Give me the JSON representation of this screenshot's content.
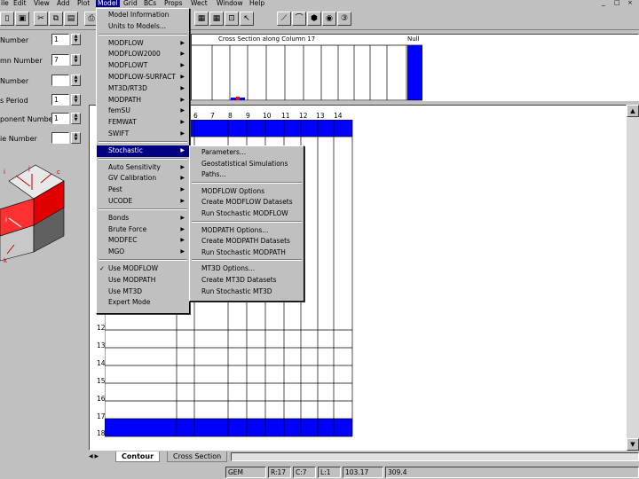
{
  "menubar": {
    "items": [
      "ile",
      "Edit",
      "View",
      "Add",
      "Plot",
      "Model",
      "Grid",
      "BCs",
      "Props",
      "Wect",
      "Window",
      "Help"
    ],
    "win_controls": [
      "_",
      "□",
      "×"
    ]
  },
  "left_panel": {
    "fields": [
      {
        "label": "Number",
        "value": "1"
      },
      {
        "label": "mn Number",
        "value": "7"
      },
      {
        "label": "Number",
        "value": ""
      },
      {
        "label": "s Period",
        "value": "1"
      },
      {
        "label": "ponent Number",
        "value": "1"
      },
      {
        "label": "ie Number",
        "value": ""
      }
    ],
    "cube_labels": [
      "i",
      "c",
      "j",
      "i",
      "k"
    ]
  },
  "cross_section": {
    "title": "Cross Section along Column 17",
    "null_label": "Null"
  },
  "grid": {
    "col_headers": [
      "6",
      "7",
      "8",
      "9",
      "10",
      "11",
      "12",
      "13",
      "14"
    ],
    "row_headers": [
      "12",
      "13",
      "14",
      "15",
      "16",
      "17",
      "18"
    ]
  },
  "tabs": {
    "contour": "Contour",
    "cross_section": "Cross Section"
  },
  "status": {
    "mode": "GEM",
    "row": "R:17",
    "col": "C:7",
    "layer": "L:1",
    "x": "103.17",
    "y": "309.4"
  },
  "model_menu": {
    "items": [
      {
        "label": "Model Information",
        "arrow": false
      },
      {
        "label": "Units to Models...",
        "arrow": false
      },
      {
        "sep": true
      },
      {
        "label": "MODFLOW",
        "arrow": true
      },
      {
        "label": "MODFLOW2000",
        "arrow": true
      },
      {
        "label": "MODFLOWT",
        "arrow": true
      },
      {
        "label": "MODFLOW-SURFACT",
        "arrow": true
      },
      {
        "label": "MT3D/RT3D",
        "arrow": true
      },
      {
        "label": "MODPATH",
        "arrow": true
      },
      {
        "label": "femSU",
        "arrow": true
      },
      {
        "label": "FEMWAT",
        "arrow": true
      },
      {
        "label": "SWIFT",
        "arrow": true
      },
      {
        "sep": true
      },
      {
        "label": "Stochastic",
        "arrow": true,
        "hl": true
      },
      {
        "sep": true
      },
      {
        "label": "Auto Sensitivity",
        "arrow": true
      },
      {
        "label": "GV Calibration",
        "arrow": true
      },
      {
        "label": "Pest",
        "arrow": true
      },
      {
        "label": "UCODE",
        "arrow": true
      },
      {
        "sep": true
      },
      {
        "label": "Bonds",
        "arrow": true
      },
      {
        "label": "Brute Force",
        "arrow": true
      },
      {
        "label": "MODFEC",
        "arrow": true
      },
      {
        "label": "MGO",
        "arrow": true
      },
      {
        "sep": true
      },
      {
        "label": "Use MODFLOW",
        "arrow": false,
        "check": true
      },
      {
        "label": "Use MODPATH",
        "arrow": false
      },
      {
        "label": "Use MT3D",
        "arrow": false
      },
      {
        "label": "Expert Mode",
        "arrow": false
      }
    ]
  },
  "stochastic_menu": {
    "items": [
      {
        "label": "Parameters..."
      },
      {
        "label": "Geostatistical Simulations"
      },
      {
        "label": "Paths..."
      },
      {
        "sep": true
      },
      {
        "label": "MODFLOW Options"
      },
      {
        "label": "Create MODFLOW Datasets"
      },
      {
        "label": "Run Stochastic MODFLOW"
      },
      {
        "sep": true
      },
      {
        "label": "MODPATH Options..."
      },
      {
        "label": "Create MODPATH Datasets"
      },
      {
        "label": "Run Stochastic MODPATH"
      },
      {
        "sep": true
      },
      {
        "label": "MT3D Options..."
      },
      {
        "label": "Create MT3D Datasets"
      },
      {
        "label": "Run Stochastic MT3D"
      }
    ]
  },
  "colors": {
    "highlight": "#000080",
    "cell_blue": "#0000ff",
    "face": "#c0c0c0"
  }
}
